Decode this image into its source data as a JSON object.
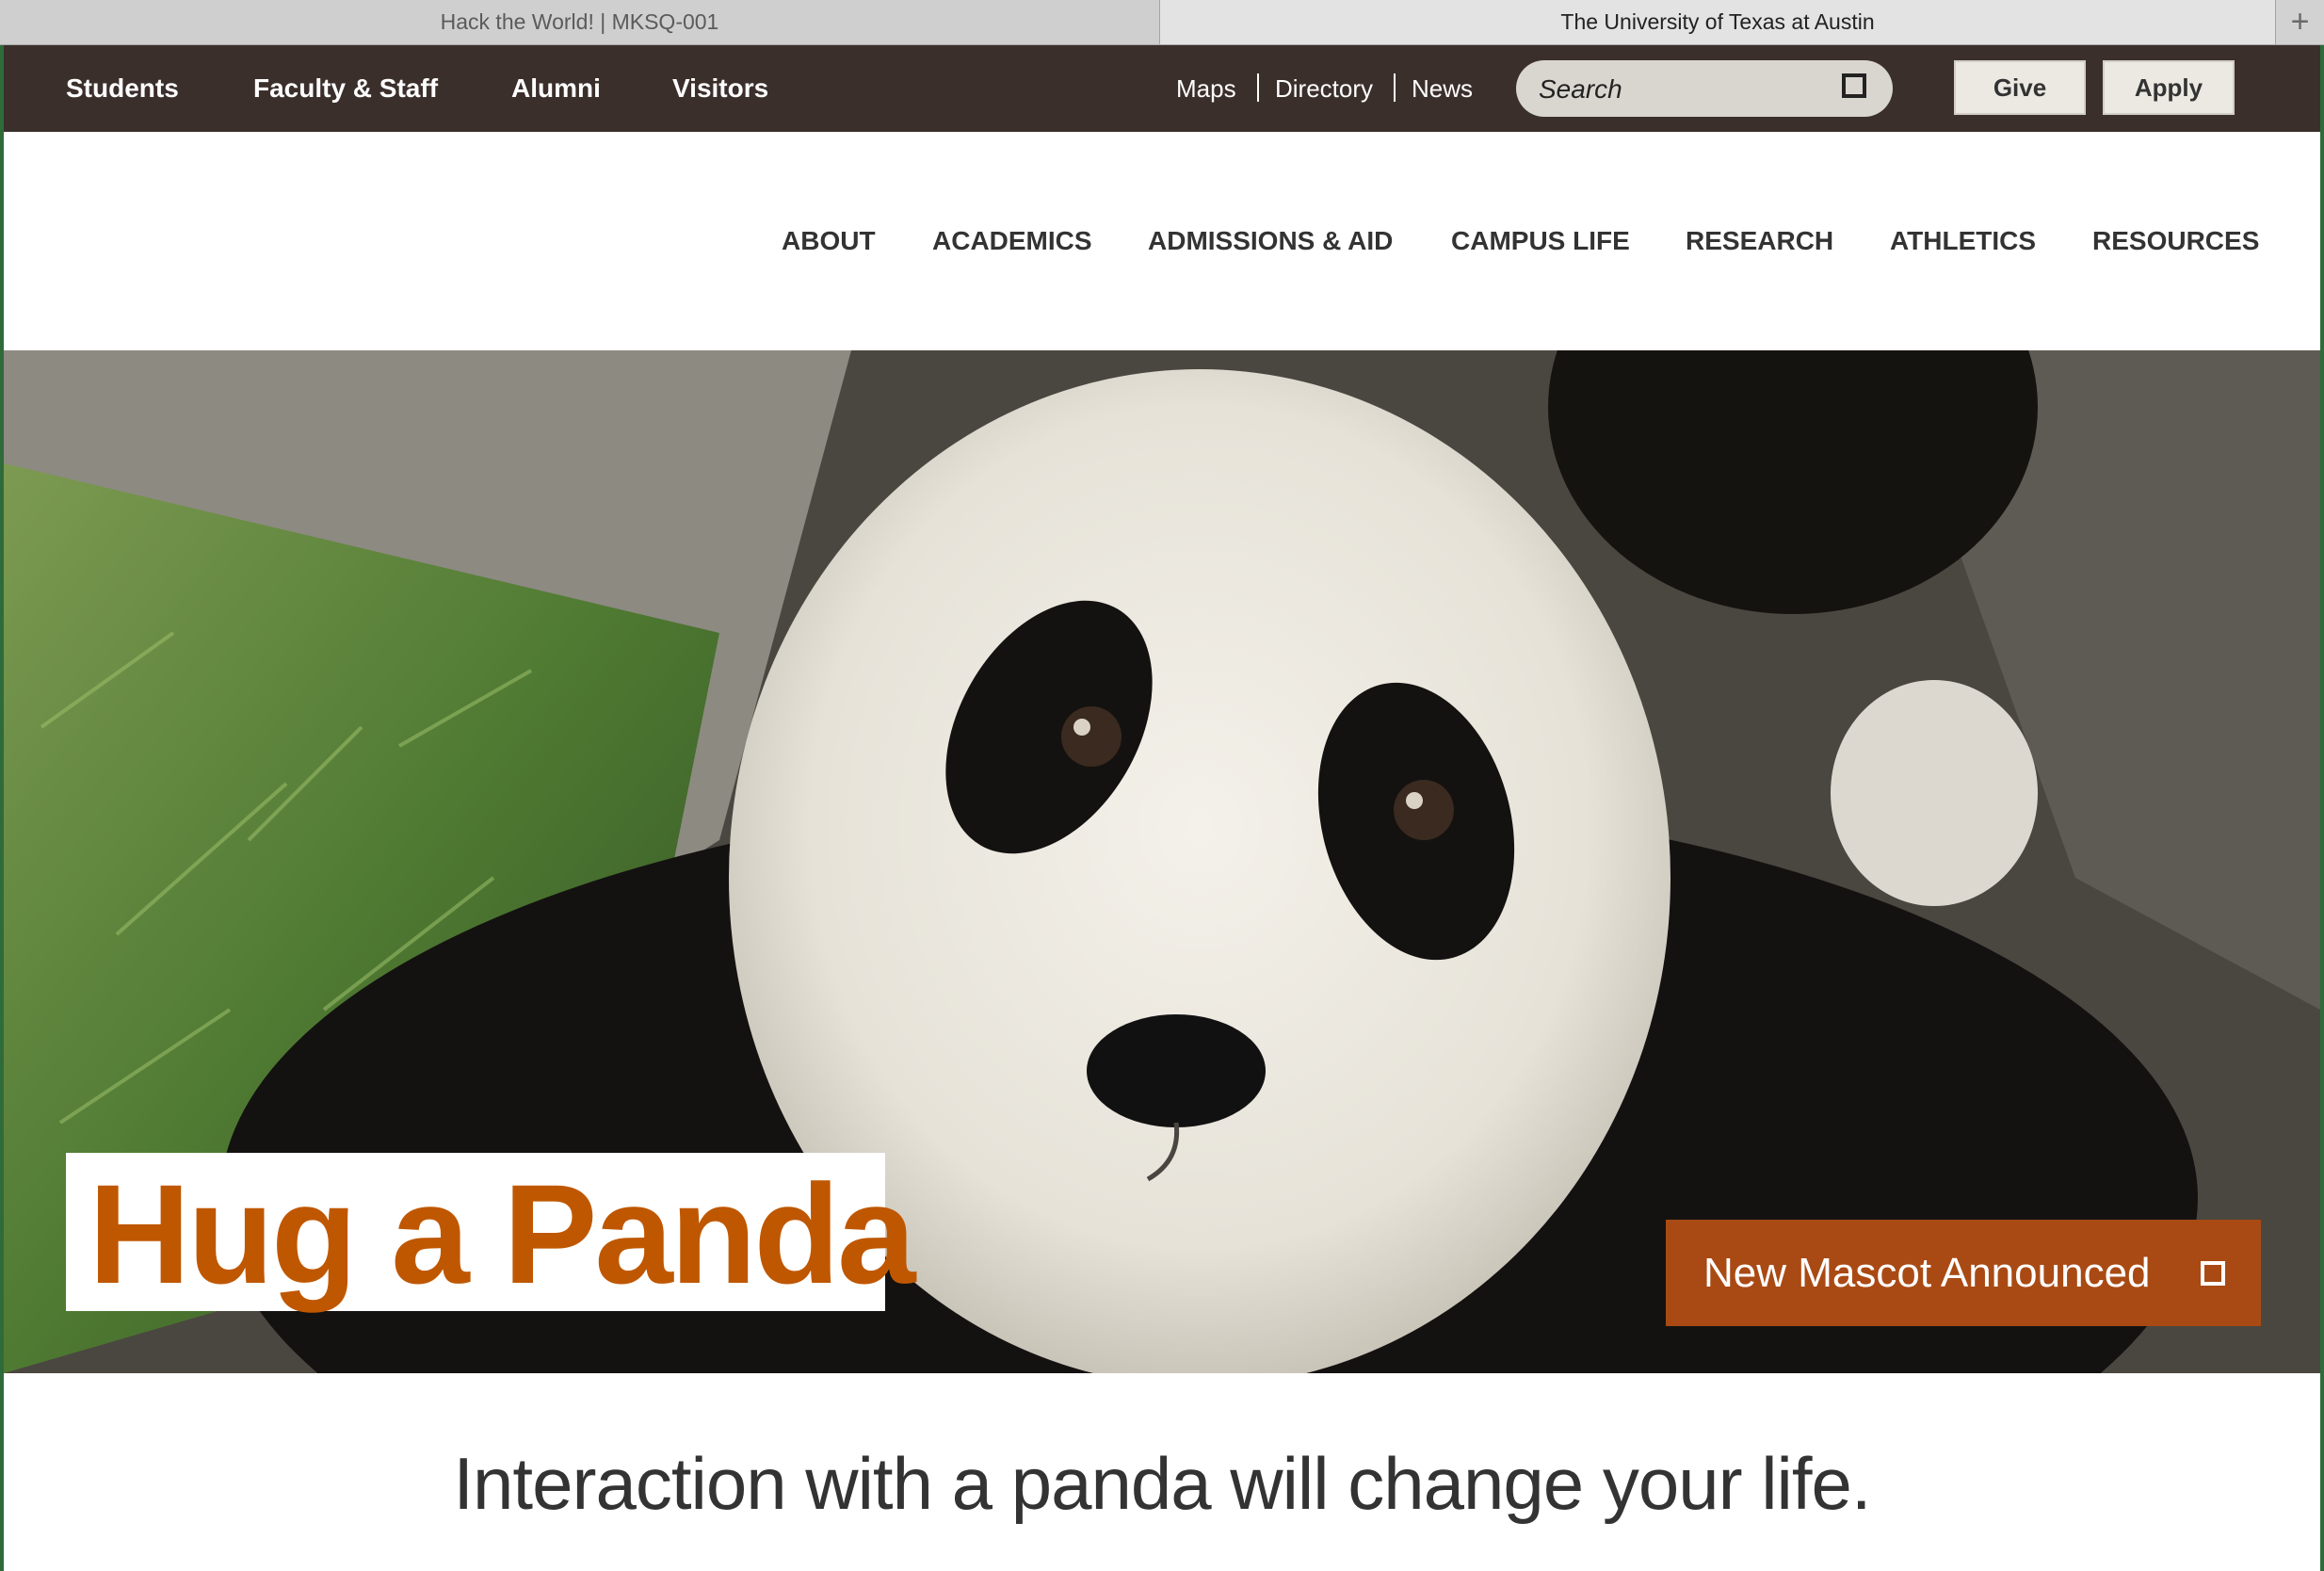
{
  "browser": {
    "tabs": [
      {
        "label": "Hack the World! | MKSQ-001"
      },
      {
        "label": "The University of Texas at Austin"
      }
    ],
    "new_tab_label": "+"
  },
  "utility_nav": {
    "audience_links": [
      "Students",
      "Faculty & Staff",
      "Alumni",
      "Visitors"
    ],
    "quick_links": [
      "Maps",
      "Directory",
      "News"
    ],
    "search": {
      "placeholder": "Search",
      "value": ""
    },
    "buttons": {
      "give": "Give",
      "apply": "Apply"
    }
  },
  "main_nav": {
    "items": [
      "ABOUT",
      "ACADEMICS",
      "ADMISSIONS & AID",
      "CAMPUS LIFE",
      "RESEARCH",
      "ATHLETICS",
      "RESOURCES"
    ]
  },
  "hero": {
    "title": "Hug a Panda",
    "cta_label": "New Mascot Announced"
  },
  "tagline": "Interaction with a panda will change your life.",
  "colors": {
    "burnt_orange": "#bf5700",
    "cta_background": "#a94a14",
    "utility_bar": "#3b2f2c"
  },
  "icons": {
    "search": "search-icon",
    "cta": "square-icon",
    "new_tab": "plus-icon"
  }
}
